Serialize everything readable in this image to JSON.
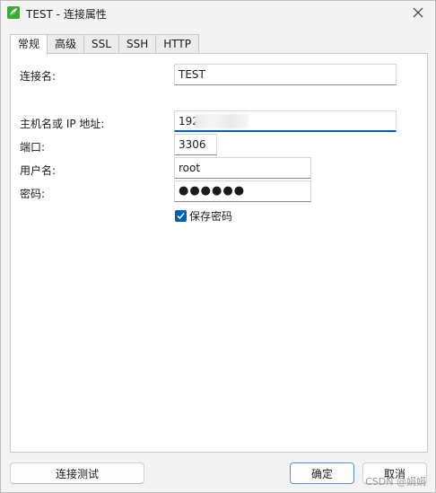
{
  "window": {
    "title": "TEST - 连接属性"
  },
  "tabs": [
    {
      "label": "常规"
    },
    {
      "label": "高级"
    },
    {
      "label": "SSL"
    },
    {
      "label": "SSH"
    },
    {
      "label": "HTTP"
    }
  ],
  "form": {
    "conn_name_label": "连接名:",
    "conn_name_value": "TEST",
    "host_label": "主机名或 IP 地址:",
    "host_value": "192",
    "port_label": "端口:",
    "port_value": "3306",
    "user_label": "用户名:",
    "user_value": "root",
    "password_label": "密码:",
    "password_value": "●●●●●●",
    "save_password_label": "保存密码",
    "save_password_checked": true
  },
  "buttons": {
    "test_connection": "连接测试",
    "ok": "确定",
    "cancel": "取消"
  },
  "watermark": "CSDN @娟娟",
  "colors": {
    "accent": "#005fb8",
    "app_icon": "#3aa935"
  },
  "icons": {
    "app": "navicat-leaf-icon",
    "close": "close-icon",
    "check": "check-icon"
  }
}
